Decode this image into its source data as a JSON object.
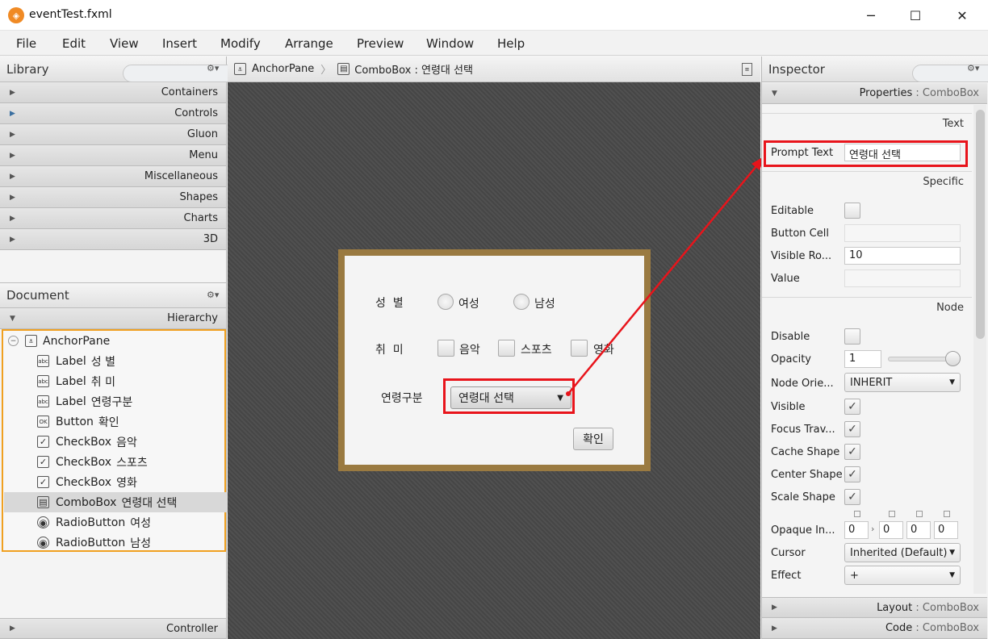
{
  "window": {
    "title": "eventTest.fxml",
    "minimize": "─",
    "maximize": "☐",
    "close": "✕"
  },
  "menu": [
    "File",
    "Edit",
    "View",
    "Insert",
    "Modify",
    "Arrange",
    "Preview",
    "Window",
    "Help"
  ],
  "library": {
    "title": "Library",
    "categories": [
      "Containers",
      "Controls",
      "Gluon",
      "Menu",
      "Miscellaneous",
      "Shapes",
      "Charts",
      "3D"
    ]
  },
  "document": {
    "title": "Document",
    "hierarchy_label": "Hierarchy",
    "root": "AnchorPane",
    "items": [
      {
        "icon": "abc",
        "type": "Label",
        "text": "성 별"
      },
      {
        "icon": "abc",
        "type": "Label",
        "text": "취 미"
      },
      {
        "icon": "abc",
        "type": "Label",
        "text": "연령구분"
      },
      {
        "icon": "OK",
        "type": "Button",
        "text": "확인"
      },
      {
        "icon": "✓",
        "type": "CheckBox",
        "text": "음악"
      },
      {
        "icon": "✓",
        "type": "CheckBox",
        "text": "스포츠"
      },
      {
        "icon": "✓",
        "type": "CheckBox",
        "text": "영화"
      },
      {
        "icon": "▤",
        "type": "ComboBox",
        "text": "연령대 선택"
      },
      {
        "icon": "◉",
        "type": "RadioButton",
        "text": "여성"
      },
      {
        "icon": "◉",
        "type": "RadioButton",
        "text": "남성"
      }
    ],
    "controller_label": "Controller"
  },
  "breadcrumb": {
    "root": "AnchorPane",
    "current": "ComboBox : 연령대 선택"
  },
  "form": {
    "gender_label": "성  별",
    "female": "여성",
    "male": "남성",
    "hobby_label": "취  미",
    "music": "음악",
    "sports": "스포츠",
    "movie": "영화",
    "age_label": "연령구분",
    "combo_prompt": "연령대 선택",
    "confirm": "확인"
  },
  "inspector": {
    "title": "Inspector",
    "properties_label": "Properties",
    "properties_target": "ComboBox",
    "sections": {
      "text": "Text",
      "specific": "Specific",
      "node": "Node"
    },
    "prompt_text_label": "Prompt Text",
    "prompt_text_value": "연령대 선택",
    "editable_label": "Editable",
    "button_cell_label": "Button Cell",
    "visible_rows_label": "Visible Ro...",
    "visible_rows_value": "10",
    "value_label": "Value",
    "disable_label": "Disable",
    "opacity_label": "Opacity",
    "opacity_value": "1",
    "node_orientation_label": "Node Orie...",
    "node_orientation_value": "INHERIT",
    "visible_label": "Visible",
    "focus_label": "Focus Trav...",
    "cache_shape_label": "Cache Shape",
    "center_shape_label": "Center Shape",
    "scale_shape_label": "Scale Shape",
    "opaque_label": "Opaque In...",
    "opaque_values": [
      "0",
      "0",
      "0",
      "0"
    ],
    "cursor_label": "Cursor",
    "cursor_value": "Inherited (Default)",
    "effect_label": "Effect",
    "effect_value": "+",
    "layout_label": "Layout",
    "code_label": "Code",
    "section_target": "ComboBox"
  },
  "colors": {
    "highlight": "#e8141b",
    "form_border": "#9a7a41",
    "selection_border": "#f0a020"
  }
}
